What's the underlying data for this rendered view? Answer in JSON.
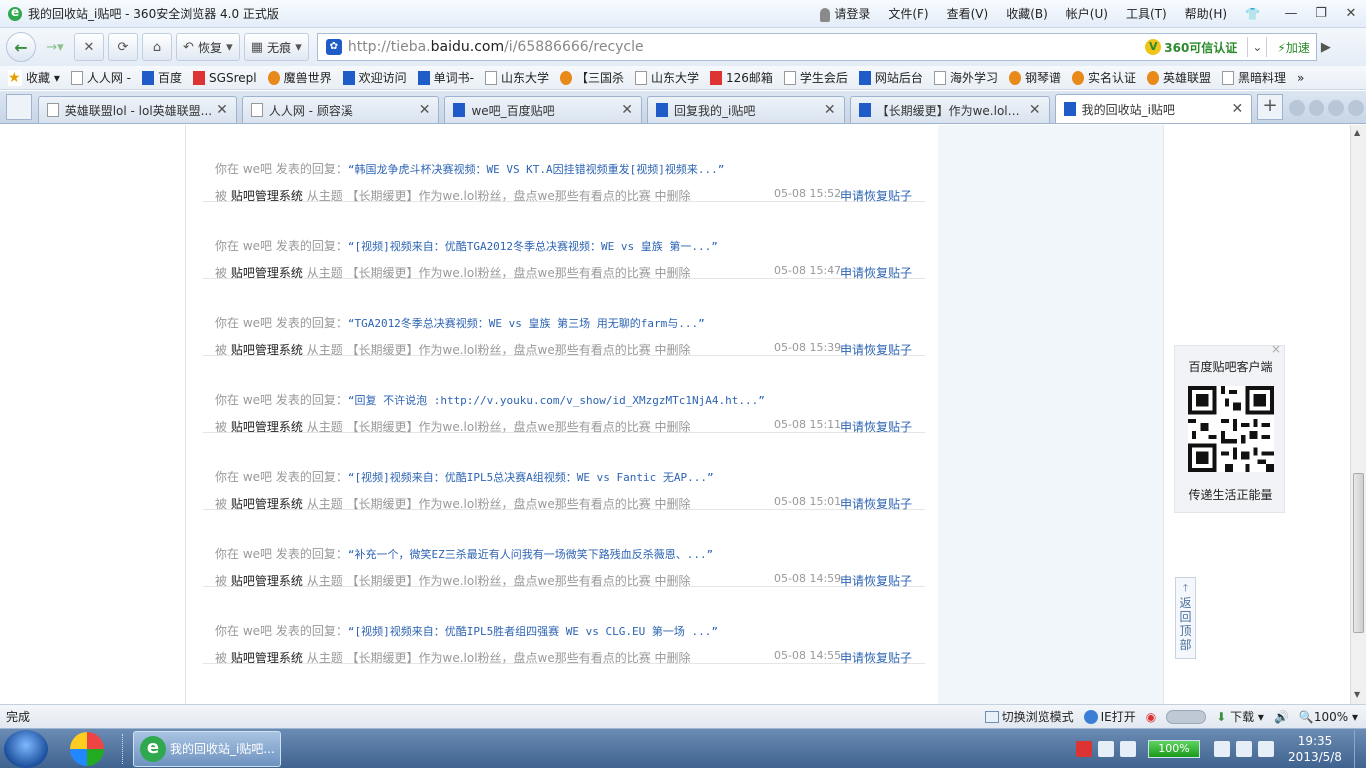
{
  "window": {
    "title": "我的回收站_i贴吧 - 360安全浏览器 4.0 正式版",
    "menu": [
      "请登录",
      "文件(F)",
      "查看(V)",
      "收藏(B)",
      "帐户(U)",
      "工具(T)",
      "帮助(H)"
    ],
    "controls": [
      "—",
      "❐",
      "✕"
    ]
  },
  "toolbar": {
    "restore_label": "恢复",
    "notrace_label": "无痕"
  },
  "address": {
    "url_prefix": "http://tieba.",
    "url_domain": "baidu.com",
    "url_path": "/i/65886666/recycle",
    "trust_label": "360可信认证",
    "accelerate_label": "加速"
  },
  "bookmarks": [
    "收藏",
    "人人网 -",
    "百度",
    "SGSrepl",
    "魔兽世界",
    "欢迎访问",
    "单词书-",
    "山东大学",
    "【三国杀",
    "山东大学",
    "126邮箱",
    "学生会后",
    "网站后台",
    "海外学习",
    "钢琴谱",
    "实名认证",
    "英雄联盟",
    "黑暗料理",
    "»"
  ],
  "tabs": [
    {
      "label": "英雄联盟lol - lol英雄联盟..."
    },
    {
      "label": "人人网 - 顾容溪"
    },
    {
      "label": "we吧_百度贴吧"
    },
    {
      "label": "回复我的_i贴吧"
    },
    {
      "label": "【长期缓更】作为we.lol粉..."
    },
    {
      "label": "我的回收站_i贴吧"
    }
  ],
  "records": [
    {
      "prefix": "你在 we吧 发表的回复：",
      "quote": "“韩国龙争虎斗杯决赛视频：WE VS KT.A因挂错视频重发[视频]视频来...”",
      "by": "被",
      "system": "贴吧管理系统",
      "from": "从主题 【长期缓更】作为we.lol粉丝，盘点we那些有看点的比赛 中删除",
      "time": "05-08 15:52",
      "action": "申请恢复贴子"
    },
    {
      "prefix": "你在 we吧 发表的回复：",
      "quote": "“[视频]视频来自：优酷TGA2012冬季总决赛视频：WE vs 皇族 第一...”",
      "by": "被",
      "system": "贴吧管理系统",
      "from": "从主题 【长期缓更】作为we.lol粉丝，盘点we那些有看点的比赛 中删除",
      "time": "05-08 15:47",
      "action": "申请恢复贴子"
    },
    {
      "prefix": "你在 we吧 发表的回复：",
      "quote": "“TGA2012冬季总决赛视频：WE vs 皇族 第三场 用无聊的farm与...”",
      "by": "被",
      "system": "贴吧管理系统",
      "from": "从主题 【长期缓更】作为we.lol粉丝，盘点we那些有看点的比赛 中删除",
      "time": "05-08 15:39",
      "action": "申请恢复贴子"
    },
    {
      "prefix": "你在 we吧 发表的回复：",
      "quote": "“回复 不许说泡 :http://v.youku.com/v_show/id_XMzgzMTc1NjA4.ht...”",
      "by": "被",
      "system": "贴吧管理系统",
      "from": "从主题 【长期缓更】作为we.lol粉丝，盘点we那些有看点的比赛 中删除",
      "time": "05-08 15:11",
      "action": "申请恢复贴子"
    },
    {
      "prefix": "你在 we吧 发表的回复：",
      "quote": "“[视频]视频来自：优酷IPL5总决赛A组视频：WE vs Fantic 无AP...”",
      "by": "被",
      "system": "贴吧管理系统",
      "from": "从主题 【长期缓更】作为we.lol粉丝，盘点we那些有看点的比赛 中删除",
      "time": "05-08 15:01",
      "action": "申请恢复贴子"
    },
    {
      "prefix": "你在 we吧 发表的回复：",
      "quote": "“补充一个，微笑EZ三杀最近有人问我有一场微笑下路残血反杀薇恩、...”",
      "by": "被",
      "system": "贴吧管理系统",
      "from": "从主题 【长期缓更】作为we.lol粉丝，盘点we那些有看点的比赛 中删除",
      "time": "05-08 14:59",
      "action": "申请恢复贴子"
    },
    {
      "prefix": "你在 we吧 发表的回复：",
      "quote": "“[视频]视频来自：优酷IPL5胜者组四强赛 WE vs CLG.EU 第一场 ...”",
      "by": "被",
      "system": "贴吧管理系统",
      "from": "从主题 【长期缓更】作为we.lol粉丝，盘点we那些有看点的比赛 中删除",
      "time": "05-08 14:55",
      "action": "申请恢复贴子"
    }
  ],
  "sidebar": {
    "qr_title": "百度贴吧客户端",
    "qr_caption": "传递生活正能量",
    "back_top": "返回顶部"
  },
  "status": {
    "done": "完成",
    "switch_mode": "切换浏览模式",
    "ie_open": "IE打开",
    "download": "下载",
    "zoom": "100%"
  },
  "taskbar": {
    "task_label": "我的回收站_i贴吧...",
    "battery": "100%",
    "time": "19:35",
    "date": "2013/5/8"
  }
}
